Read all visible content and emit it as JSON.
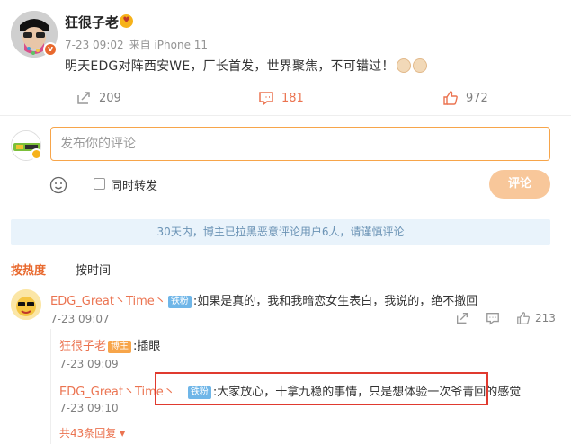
{
  "post": {
    "author": "狂很子老",
    "time": "7-23 09:02",
    "source": "来自 iPhone 11",
    "text": "明天EDG对阵西安WE，厂长首发，世界聚焦，不可错过！",
    "actions": {
      "repost": "209",
      "comments": "181",
      "likes": "972"
    }
  },
  "composer": {
    "placeholder": "发布你的评论",
    "repost_label": "同时转发",
    "submit_label": "评论"
  },
  "notice": "30天内，博主已拉黑恶意评论用户6人，请谨慎评论",
  "sort": {
    "hot": "按热度",
    "time": "按时间"
  },
  "comment": {
    "author": "EDG_Great丶Time丶",
    "badge": "铁粉",
    "text": ":如果是真的，我和我暗恋女生表白，我说的，绝不撤回",
    "time": "7-23 09:07",
    "likes": "213"
  },
  "replies": [
    {
      "author": "狂很子老",
      "badge": "博主",
      "text": ":插眼",
      "time": "7-23 09:09"
    },
    {
      "author": "EDG_Great丶Time丶",
      "badge": "铁粉",
      "text": ":大家放心，十拿九稳的事情，只是想体验一次爷青回的感觉",
      "time": "7-23 09:10"
    }
  ],
  "more_replies": "共43条回复",
  "colors": {
    "accent": "#eb7350",
    "highlight": "#e03a2f",
    "notice_bg": "#e9f3fb"
  }
}
